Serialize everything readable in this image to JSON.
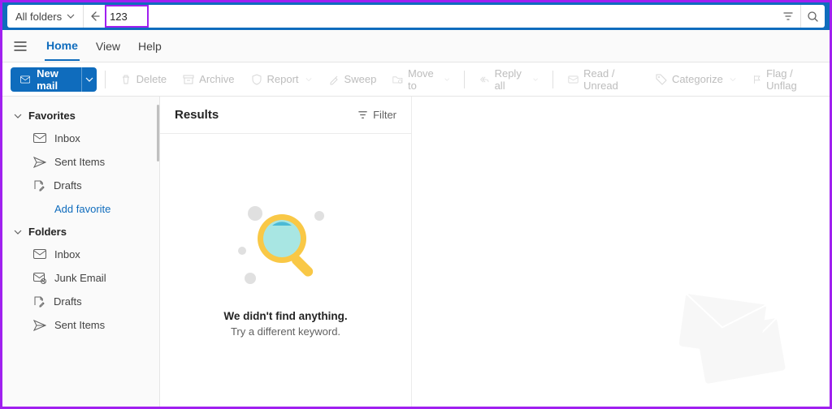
{
  "search": {
    "scope": "All folders",
    "value": "123"
  },
  "tabs": {
    "home": "Home",
    "view": "View",
    "help": "Help"
  },
  "toolbar": {
    "new_mail": "New mail",
    "delete": "Delete",
    "archive": "Archive",
    "report": "Report",
    "sweep": "Sweep",
    "move_to": "Move to",
    "reply_all": "Reply all",
    "read_unread": "Read / Unread",
    "categorize": "Categorize",
    "flag_unflag": "Flag / Unflag"
  },
  "sidebar": {
    "favorites": "Favorites",
    "fav_items": [
      {
        "key": "inbox",
        "label": "Inbox"
      },
      {
        "key": "sent",
        "label": "Sent Items"
      },
      {
        "key": "drafts",
        "label": "Drafts"
      }
    ],
    "add_favorite": "Add favorite",
    "folders": "Folders",
    "folder_items": [
      {
        "key": "inbox",
        "label": "Inbox"
      },
      {
        "key": "junk",
        "label": "Junk Email"
      },
      {
        "key": "drafts",
        "label": "Drafts"
      },
      {
        "key": "sent",
        "label": "Sent Items"
      }
    ]
  },
  "results": {
    "title": "Results",
    "filter": "Filter",
    "empty_title": "We didn't find anything.",
    "empty_sub": "Try a different keyword."
  }
}
